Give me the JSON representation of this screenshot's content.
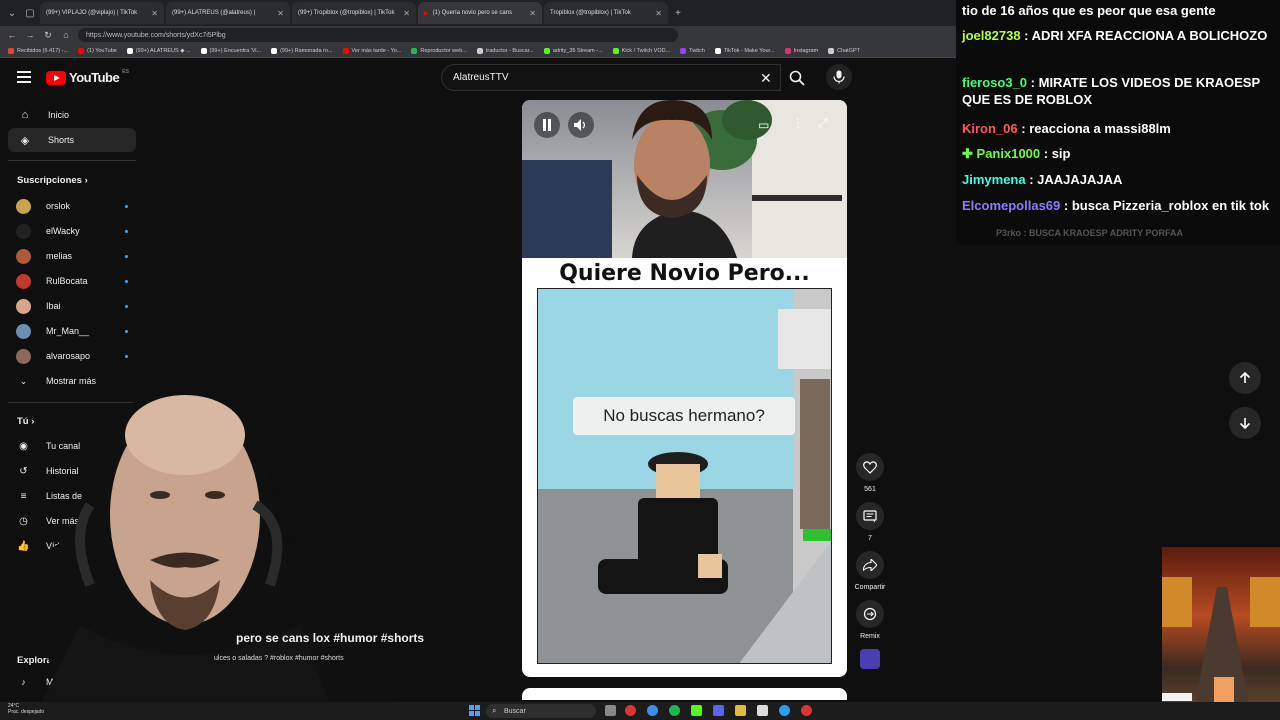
{
  "browser": {
    "tabs": [
      {
        "label": "(99+) VIPLAJO (@viplajo) | TikTok",
        "active": false
      },
      {
        "label": "(99+) ALATREUS (@alatreus) |",
        "active": false
      },
      {
        "label": "(99+) Tropiblox (@tropiblox) | TikTok",
        "active": false
      },
      {
        "label": "(1) Quería novio pero se cans",
        "active": true
      },
      {
        "label": "Tropiblox (@tropiblox) | TikTok",
        "active": false
      }
    ],
    "url": "https://www.youtube.com/shorts/ydXc7i5Plbg",
    "bookmarks": [
      {
        "label": "Recibidos (6.417) -...",
        "color": "#ea4335"
      },
      {
        "label": "(1) YouTube",
        "color": "#ff0000"
      },
      {
        "label": "(99+) ALATREUS ◆ ...",
        "color": "#ffffff"
      },
      {
        "label": "(99+) Encuentra 'Vi...",
        "color": "#ffffff"
      },
      {
        "label": "(99+) Ramonada ro...",
        "color": "#ffffff"
      },
      {
        "label": "Ver más tarde - Yo...",
        "color": "#ff0000"
      },
      {
        "label": "Reproductor web...",
        "color": "#1db954"
      },
      {
        "label": "traductor - Buscar...",
        "color": "#cccccc"
      },
      {
        "label": "adrity_35 Stream -...",
        "color": "#53fc18"
      },
      {
        "label": "Kick / Twitch VOD...",
        "color": "#53fc18"
      },
      {
        "label": "Twitch",
        "color": "#9146ff"
      },
      {
        "label": "TikTok - Make Your...",
        "color": "#ffffff"
      },
      {
        "label": "Instagram",
        "color": "#e1306c"
      },
      {
        "label": "ChatGPT",
        "color": "#cccccc"
      }
    ]
  },
  "youtube": {
    "logo_text": "YouTube",
    "logo_country": "ES",
    "search_value": "AlatreusTTV"
  },
  "sidebar": {
    "main": [
      {
        "label": "Inicio",
        "icon": "home-icon"
      },
      {
        "label": "Shorts",
        "icon": "shorts-icon"
      }
    ],
    "subs_heading": "Suscripciones",
    "subs": [
      {
        "label": "orslok",
        "color": "#c9a44b"
      },
      {
        "label": "elWacky",
        "color": "#222222"
      },
      {
        "label": "melias",
        "color": "#b05a3a"
      },
      {
        "label": "RulBocata",
        "color": "#c0392b"
      },
      {
        "label": "Ibai",
        "color": "#d9a58a"
      },
      {
        "label": "Mr_Man__",
        "color": "#6a8fb0"
      },
      {
        "label": "alvarosapo",
        "color": "#8c6a5a"
      }
    ],
    "show_more": "Mostrar más",
    "you_heading": "Tú",
    "you_items": [
      {
        "label": "Tu canal"
      },
      {
        "label": "Historial"
      },
      {
        "label": "Listas de"
      },
      {
        "label": "Ver más"
      },
      {
        "label": "Vídeos que"
      }
    ],
    "explore_heading": "Explorar",
    "explore_items": [
      {
        "label": "Música"
      }
    ]
  },
  "short": {
    "headline": "Quiere Novio Pero...",
    "speech_text": "No buscas hermano?",
    "title": "pero se cans       lox #humor #shorts",
    "subtitle": "ulces o saladas ? #roblox #humor #shorts",
    "likes": "561",
    "comments": "7",
    "share_label": "Compartir",
    "remix_label": "Remix"
  },
  "chat": {
    "lines": [
      {
        "user": "",
        "color": "#ffffff",
        "text": "tio de 16 años que es peor que esa gente"
      },
      {
        "user": "joel82738",
        "color": "#b7ff3c",
        "text": "ADRI XFA REACCIONA A BOLICHOZO"
      },
      {
        "user": "fieroso3_0",
        "color": "#3cff7a",
        "text": "MIRATE LOS VIDEOS DE KRAOESP QUE ES DE ROBLOX"
      },
      {
        "user": "Kiron_06",
        "color": "#ff5a5a",
        "text": "reacciona a massi88lm"
      },
      {
        "user": "Panix1000",
        "color": "#6aff3c",
        "text": "sip"
      },
      {
        "user": "Jimymena",
        "color": "#3cffe0",
        "text": "JAAJAJAJAA"
      },
      {
        "user": "Elcomepollas69",
        "color": "#8a7dff",
        "text": "busca Pizzeria_roblox en tik tok"
      }
    ],
    "faded": "P3rko : BUSCA KRAOESP ADRITY PORFAA"
  },
  "taskbar": {
    "temp": "24°C",
    "weather": "Prac. despejado",
    "search_label": "Buscar"
  }
}
